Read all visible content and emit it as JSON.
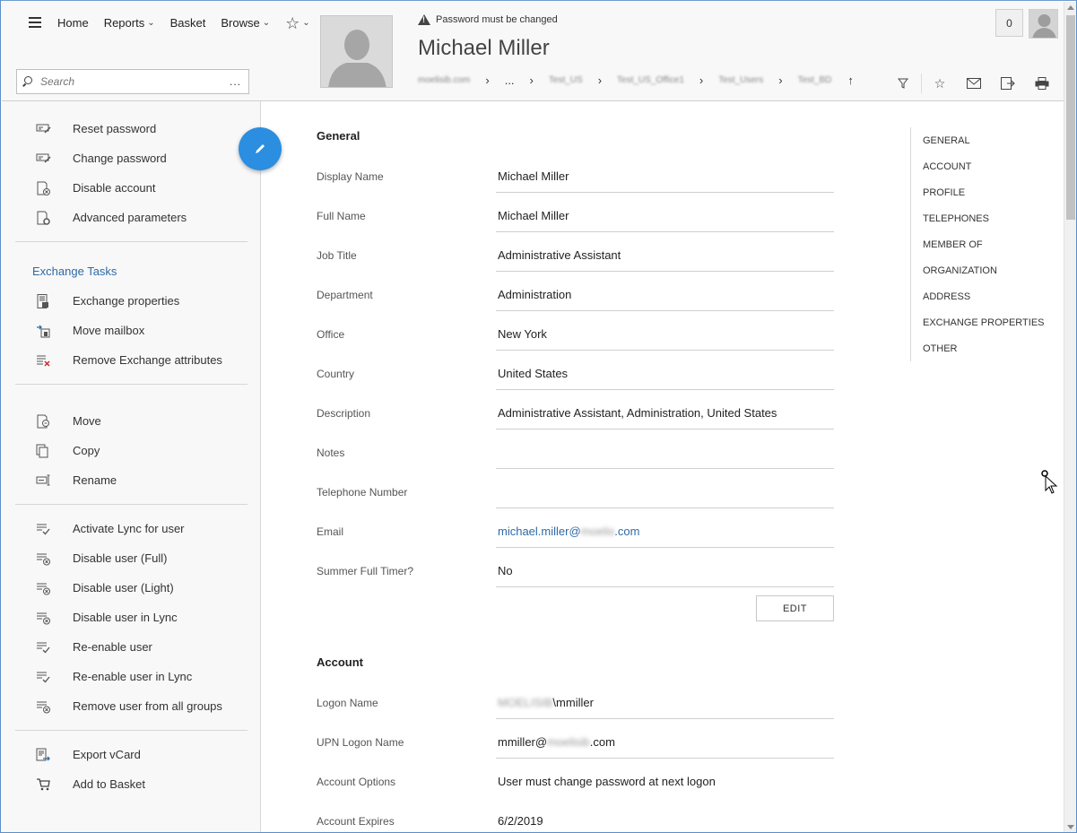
{
  "header": {
    "nav": [
      {
        "label": "Home",
        "caret": false
      },
      {
        "label": "Reports",
        "caret": true
      },
      {
        "label": "Basket",
        "caret": false
      },
      {
        "label": "Browse",
        "caret": true
      }
    ],
    "search_placeholder": "Search",
    "search_more": "...",
    "warning": "Password must be changed",
    "title": "Michael Miller",
    "breadcrumb": [
      "moelisib.com",
      "...",
      "Test_US",
      "Test_US_Office1",
      "Test_Users",
      "Test_BD"
    ],
    "basket_count": "0"
  },
  "sidebar": {
    "group1": [
      {
        "label": "Reset password",
        "icon": "reset-password-icon"
      },
      {
        "label": "Change password",
        "icon": "change-password-icon"
      },
      {
        "label": "Disable account",
        "icon": "disable-account-icon"
      },
      {
        "label": "Advanced parameters",
        "icon": "advanced-parameters-icon"
      }
    ],
    "exchange_title": "Exchange Tasks",
    "group2": [
      {
        "label": "Exchange properties",
        "icon": "exchange-properties-icon"
      },
      {
        "label": "Move mailbox",
        "icon": "move-mailbox-icon"
      },
      {
        "label": "Remove Exchange attributes",
        "icon": "remove-exchange-icon"
      }
    ],
    "group3": [
      {
        "label": "Move",
        "icon": "move-icon"
      },
      {
        "label": "Copy",
        "icon": "copy-icon"
      },
      {
        "label": "Rename",
        "icon": "rename-icon"
      }
    ],
    "group4": [
      {
        "label": "Activate Lync for user",
        "icon": "activate-lync-icon"
      },
      {
        "label": "Disable user (Full)",
        "icon": "disable-user-full-icon"
      },
      {
        "label": "Disable user (Light)",
        "icon": "disable-user-light-icon"
      },
      {
        "label": "Disable user in Lync",
        "icon": "disable-lync-icon"
      },
      {
        "label": "Re-enable user",
        "icon": "reenable-user-icon"
      },
      {
        "label": "Re-enable user in Lync",
        "icon": "reenable-lync-icon"
      },
      {
        "label": "Remove user from all groups",
        "icon": "remove-groups-icon"
      }
    ],
    "group5": [
      {
        "label": "Export vCard",
        "icon": "export-vcard-icon"
      },
      {
        "label": "Add to Basket",
        "icon": "basket-icon"
      }
    ]
  },
  "general": {
    "title": "General",
    "fields": [
      {
        "label": "Display Name",
        "value": "Michael Miller"
      },
      {
        "label": "Full Name",
        "value": "Michael Miller"
      },
      {
        "label": "Job Title",
        "value": "Administrative Assistant"
      },
      {
        "label": "Department",
        "value": "Administration"
      },
      {
        "label": "Office",
        "value": "New York"
      },
      {
        "label": "Country",
        "value": "United States"
      },
      {
        "label": "Description",
        "value": "Administrative Assistant, Administration, United States"
      },
      {
        "label": "Notes",
        "value": ""
      },
      {
        "label": "Telephone Number",
        "value": ""
      },
      {
        "label": "Email",
        "value_prefix": "michael.miller@",
        "value_blur": "moelis",
        "value_suffix": ".com"
      },
      {
        "label": "Summer Full Timer?",
        "value": "No"
      }
    ],
    "edit_label": "EDIT"
  },
  "account": {
    "title": "Account",
    "logon_label": "Logon Name",
    "logon_blur": "MOELISIB",
    "logon_suffix": "\\mmiller",
    "upn_label": "UPN Logon Name",
    "upn_prefix": "mmiller@",
    "upn_blur": "moelisib",
    "upn_suffix": ".com",
    "options_label": "Account Options",
    "options_value": "User must change password at next logon",
    "expires_label": "Account Expires",
    "expires_value": "6/2/2019"
  },
  "right_nav": [
    "GENERAL",
    "ACCOUNT",
    "PROFILE",
    "TELEPHONES",
    "MEMBER OF",
    "ORGANIZATION",
    "ADDRESS",
    "EXCHANGE PROPERTIES",
    "OTHER"
  ],
  "colors": {
    "accent": "#2b8ee0",
    "link": "#2f6aa6"
  }
}
